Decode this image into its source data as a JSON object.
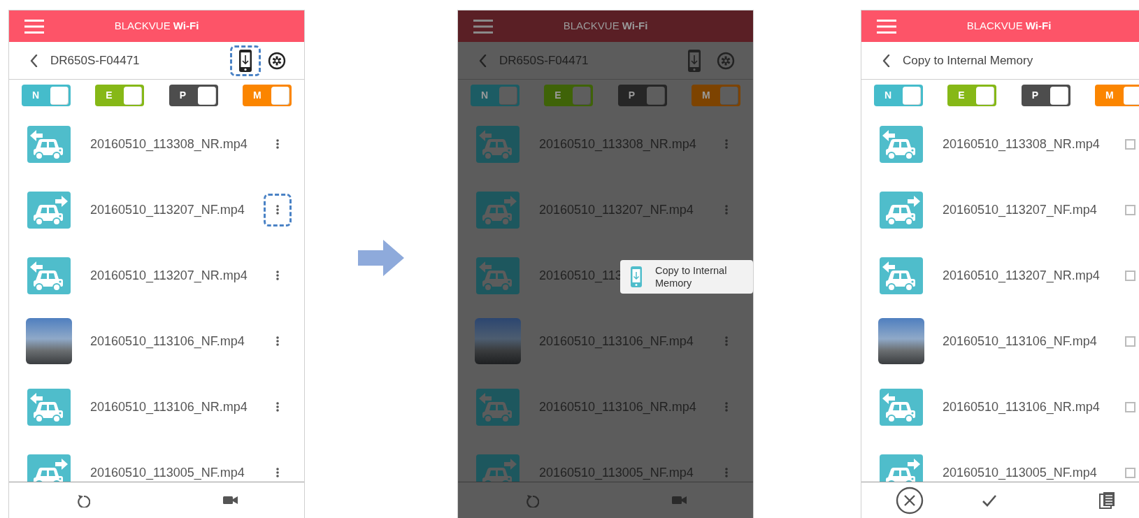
{
  "screens": [
    {
      "kind": "browse",
      "dimmed": false,
      "title": "BLACKVUE **Wi-Fi**",
      "subtitle": "DR650S-F04471",
      "download_highlighted": true,
      "toggles": [
        {
          "label": "N",
          "on": true,
          "color": "#45bccb"
        },
        {
          "label": "E",
          "on": true,
          "color": "#86b817"
        },
        {
          "label": "P",
          "on": true,
          "color": "#4d4d4d"
        },
        {
          "label": "M",
          "on": true,
          "color": "#fb8500"
        }
      ],
      "rows": [
        {
          "name": "20160510_113308_NR.mp4",
          "kind": "rear",
          "highlighted": false
        },
        {
          "name": "20160510_113207_NF.mp4",
          "kind": "front",
          "highlighted": true
        },
        {
          "name": "20160510_113207_NR.mp4",
          "kind": "rear",
          "highlighted": false
        },
        {
          "name": "20160510_113106_NF.mp4",
          "kind": "photo",
          "highlighted": false
        },
        {
          "name": "20160510_113106_NR.mp4",
          "kind": "rear",
          "highlighted": false
        },
        {
          "name": "20160510_113005_NF.mp4",
          "kind": "front",
          "highlighted": false
        }
      ]
    },
    {
      "kind": "browse",
      "dimmed": true,
      "title": "BLACKVUE **Wi-Fi**",
      "subtitle": "DR650S-F04471",
      "download_highlighted": false,
      "toggles": [
        {
          "label": "N",
          "on": true,
          "color": "#1c5c64"
        },
        {
          "label": "E",
          "on": true,
          "color": "#3f6308"
        },
        {
          "label": "P",
          "on": true,
          "color": "#262626"
        },
        {
          "label": "M",
          "on": true,
          "color": "#7d4300"
        }
      ],
      "rows": [
        {
          "name": "20160510_113308_NR.mp4",
          "kind": "rear"
        },
        {
          "name": "20160510_113207_NF.mp4",
          "kind": "front"
        },
        {
          "name": "20160510_113",
          "kind": "rear"
        },
        {
          "name": "20160510_113106_NF.mp4",
          "kind": "photo"
        },
        {
          "name": "20160510_113106_NR.mp4",
          "kind": "rear"
        },
        {
          "name": "20160510_113005_NF.mp4",
          "kind": "front"
        }
      ],
      "popup": {
        "label": "Copy to Internal Memory"
      }
    },
    {
      "kind": "select",
      "dimmed": false,
      "title": "BLACKVUE **Wi-Fi**",
      "subtitle": "Copy to Internal Memory",
      "toggles": [
        {
          "label": "N",
          "on": true,
          "color": "#45bccb"
        },
        {
          "label": "E",
          "on": true,
          "color": "#86b817"
        },
        {
          "label": "P",
          "on": true,
          "color": "#4d4d4d"
        },
        {
          "label": "M",
          "on": true,
          "color": "#fb8500"
        }
      ],
      "rows": [
        {
          "name": "20160510_113308_NR.mp4",
          "kind": "rear",
          "checked": false
        },
        {
          "name": "20160510_113207_NF.mp4",
          "kind": "front",
          "checked": false
        },
        {
          "name": "20160510_113207_NR.mp4",
          "kind": "rear",
          "checked": false
        },
        {
          "name": "20160510_113106_NF.mp4",
          "kind": "photo",
          "checked": false
        },
        {
          "name": "20160510_113106_NR.mp4",
          "kind": "rear",
          "checked": false
        },
        {
          "name": "20160510_113005_NF.mp4",
          "kind": "front",
          "checked": false
        }
      ]
    }
  ]
}
